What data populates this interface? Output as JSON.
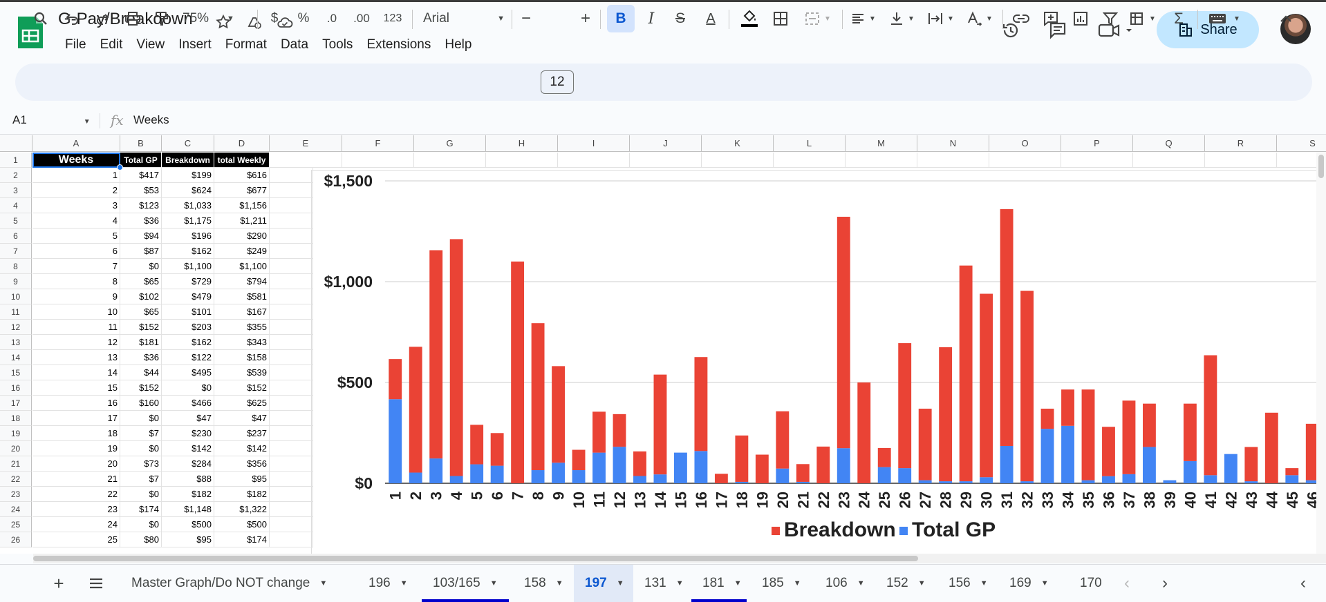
{
  "document": {
    "title": "G-Pay/Breakdown"
  },
  "menu": [
    "File",
    "Edit",
    "View",
    "Insert",
    "Format",
    "Data",
    "Tools",
    "Extensions",
    "Help"
  ],
  "share": {
    "label": "Share"
  },
  "toolbar": {
    "zoom": "75%",
    "currency": "$",
    "percent": "%",
    "dec_less": ".0",
    "dec_more": ".00",
    "format_123": "123",
    "font": "Arial",
    "font_size": "12"
  },
  "formula_bar": {
    "cell_ref": "A1",
    "value": "Weeks"
  },
  "columns": [
    "A",
    "B",
    "C",
    "D",
    "E",
    "F",
    "G",
    "H",
    "I",
    "J",
    "K",
    "L",
    "M",
    "N",
    "O",
    "P",
    "Q",
    "R",
    "S"
  ],
  "sheet": {
    "headers": [
      "Weeks",
      "Total GP",
      "Breakdown",
      "total Weekly"
    ],
    "rows": [
      [
        "1",
        "$417",
        "$199",
        "$616"
      ],
      [
        "2",
        "$53",
        "$624",
        "$677"
      ],
      [
        "3",
        "$123",
        "$1,033",
        "$1,156"
      ],
      [
        "4",
        "$36",
        "$1,175",
        "$1,211"
      ],
      [
        "5",
        "$94",
        "$196",
        "$290"
      ],
      [
        "6",
        "$87",
        "$162",
        "$249"
      ],
      [
        "7",
        "$0",
        "$1,100",
        "$1,100"
      ],
      [
        "8",
        "$65",
        "$729",
        "$794"
      ],
      [
        "9",
        "$102",
        "$479",
        "$581"
      ],
      [
        "10",
        "$65",
        "$101",
        "$167"
      ],
      [
        "11",
        "$152",
        "$203",
        "$355"
      ],
      [
        "12",
        "$181",
        "$162",
        "$343"
      ],
      [
        "13",
        "$36",
        "$122",
        "$158"
      ],
      [
        "14",
        "$44",
        "$495",
        "$539"
      ],
      [
        "15",
        "$152",
        "$0",
        "$152"
      ],
      [
        "16",
        "$160",
        "$466",
        "$625"
      ],
      [
        "17",
        "$0",
        "$47",
        "$47"
      ],
      [
        "18",
        "$7",
        "$230",
        "$237"
      ],
      [
        "19",
        "$0",
        "$142",
        "$142"
      ],
      [
        "20",
        "$73",
        "$284",
        "$356"
      ],
      [
        "21",
        "$7",
        "$88",
        "$95"
      ],
      [
        "22",
        "$0",
        "$182",
        "$182"
      ],
      [
        "23",
        "$174",
        "$1,148",
        "$1,322"
      ],
      [
        "24",
        "$0",
        "$500",
        "$500"
      ],
      [
        "25",
        "$80",
        "$95",
        "$174"
      ]
    ]
  },
  "chart_data": {
    "type": "bar",
    "stacked": true,
    "categories": [
      "1",
      "2",
      "3",
      "4",
      "5",
      "6",
      "7",
      "8",
      "9",
      "10",
      "11",
      "12",
      "13",
      "14",
      "15",
      "16",
      "17",
      "18",
      "19",
      "20",
      "21",
      "22",
      "23",
      "24",
      "25",
      "26",
      "27",
      "28",
      "29",
      "30",
      "31",
      "32",
      "33",
      "34",
      "35",
      "36",
      "37",
      "38",
      "39",
      "40",
      "41",
      "42",
      "43",
      "44",
      "45",
      "46"
    ],
    "series": [
      {
        "name": "Total GP",
        "color": "#4285f4",
        "values": [
          417,
          53,
          123,
          36,
          94,
          87,
          0,
          65,
          102,
          65,
          152,
          181,
          36,
          44,
          152,
          160,
          0,
          7,
          0,
          73,
          7,
          0,
          174,
          0,
          80,
          75,
          15,
          10,
          10,
          30,
          185,
          10,
          270,
          285,
          15,
          35,
          45,
          180,
          15,
          110,
          40,
          145,
          10,
          0,
          40,
          15
        ]
      },
      {
        "name": "Breakdown",
        "color": "#ea4335",
        "values": [
          199,
          624,
          1033,
          1175,
          196,
          162,
          1100,
          729,
          479,
          101,
          203,
          162,
          122,
          495,
          0,
          466,
          47,
          230,
          142,
          284,
          88,
          182,
          1148,
          500,
          95,
          620,
          355,
          665,
          1070,
          910,
          1175,
          945,
          100,
          180,
          450,
          245,
          365,
          215,
          0,
          285,
          595,
          0,
          170,
          350,
          35,
          280
        ]
      }
    ],
    "y_ticks": [
      "$0",
      "$500",
      "$1,000",
      "$1,500"
    ],
    "ylim": [
      0,
      1500
    ],
    "legend": {
      "position": "bottom",
      "entries": [
        "Breakdown",
        "Total GP"
      ]
    }
  },
  "tabs": {
    "items": [
      {
        "label": "Master Graph/Do NOT change"
      },
      {
        "label": "196"
      },
      {
        "label": "103/165"
      },
      {
        "label": "158"
      },
      {
        "label": "197"
      },
      {
        "label": "131"
      },
      {
        "label": "181"
      },
      {
        "label": "185"
      },
      {
        "label": "106"
      },
      {
        "label": "152"
      },
      {
        "label": "156"
      },
      {
        "label": "169"
      },
      {
        "label": "170"
      }
    ],
    "active": "197"
  }
}
